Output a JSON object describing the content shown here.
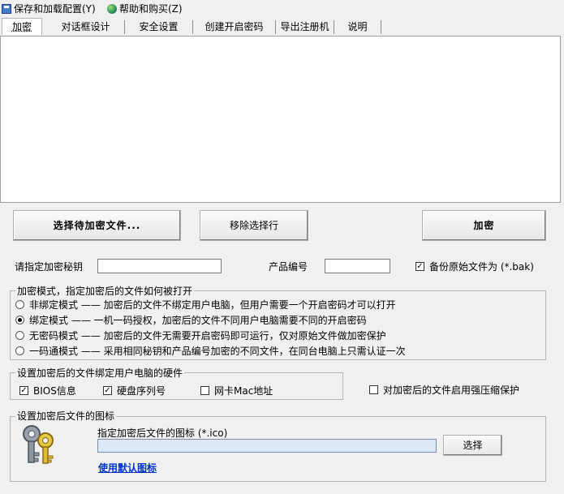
{
  "menu": {
    "save_load": "保存和加载配置(Y)",
    "help_buy": "帮助和购买(Z)"
  },
  "tabs": [
    "加密",
    "对话框设计",
    "安全设置",
    "创建开启密码",
    "导出注册机",
    "说明"
  ],
  "buttons": {
    "select_files": "选择待加密文件...",
    "remove_row": "移除选择行",
    "encrypt": "加密",
    "choose": "选择"
  },
  "fields": {
    "secret_key_label": "请指定加密秘钥",
    "secret_key_value": "",
    "product_id_label": "产品编号",
    "product_id_value": "",
    "backup_label": "备份原始文件为 (*.bak)",
    "backup_checked": true
  },
  "mode_group": {
    "legend": "加密模式，指定加密后的文件如何被打开",
    "options": [
      {
        "label": "非绑定模式 —— 加密后的文件不绑定用户电脑，但用户需要一个开启密码才可以打开",
        "selected": false
      },
      {
        "label": "绑定模式 —— 一机一码授权，加密后的文件不同用户电脑需要不同的开启密码",
        "selected": true
      },
      {
        "label": "无密码模式 —— 加密后的文件无需要开启密码即可运行，仅对原始文件做加密保护",
        "selected": false
      },
      {
        "label": "一码通模式 —— 采用相同秘钥和产品编号加密的不同文件，在同台电脑上只需认证一次",
        "selected": false
      }
    ]
  },
  "hardware_group": {
    "legend": "设置加密后的文件绑定用户电脑的硬件",
    "bios": "BIOS信息",
    "bios_checked": true,
    "disk": "硬盘序列号",
    "disk_checked": true,
    "mac": "网卡Mac地址",
    "mac_checked": false
  },
  "compress": {
    "label": "对加密后的文件启用强压缩保护",
    "checked": false
  },
  "icon_group": {
    "legend": "设置加密后文件的图标",
    "path_label": "指定加密后文件的图标 (*.ico)",
    "path_value": "",
    "default_link": "使用默认图标"
  },
  "check_mark": "✓",
  "icons": {
    "save": "disk-icon",
    "help": "globe-icon",
    "keys": "keys-icon"
  }
}
